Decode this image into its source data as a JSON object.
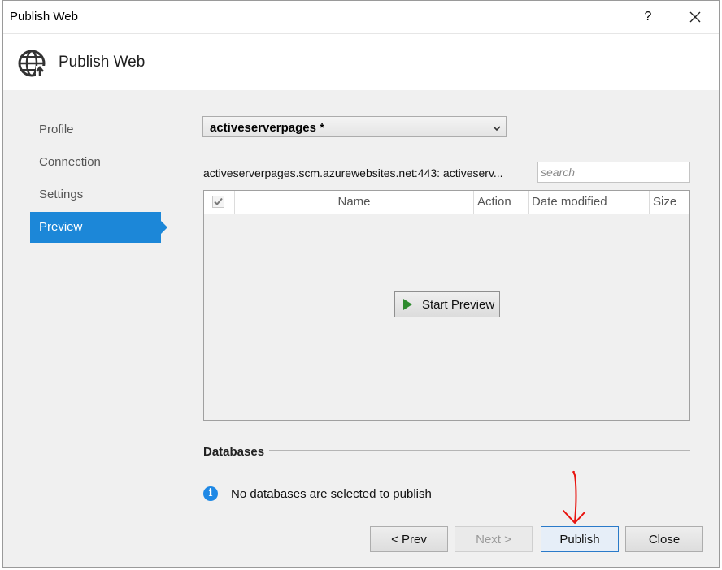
{
  "window": {
    "title": "Publish Web",
    "help_label": "?",
    "close_icon": "close-icon"
  },
  "header": {
    "title": "Publish Web",
    "icon": "globe-publish-icon"
  },
  "nav": {
    "items": [
      {
        "label": "Profile",
        "active": false
      },
      {
        "label": "Connection",
        "active": false
      },
      {
        "label": "Settings",
        "active": false
      },
      {
        "label": "Preview",
        "active": true
      }
    ]
  },
  "profile": {
    "selected": "activeserverpages *"
  },
  "connection": {
    "url_text": "activeserverpages.scm.azurewebsites.net:443: activeserv..."
  },
  "search": {
    "placeholder": "search",
    "value": ""
  },
  "grid": {
    "columns": [
      "Name",
      "Action",
      "Date modified",
      "Size"
    ],
    "rows": [],
    "start_preview_label": "Start Preview"
  },
  "databases": {
    "heading": "Databases",
    "message": "No databases are selected to publish"
  },
  "footer": {
    "prev_label": "< Prev",
    "next_label": "Next >",
    "publish_label": "Publish",
    "close_label": "Close"
  },
  "colors": {
    "accent": "#1c87d8",
    "annotation": "#e8140f",
    "play": "#2e8b2e",
    "info": "#1e88e5"
  }
}
